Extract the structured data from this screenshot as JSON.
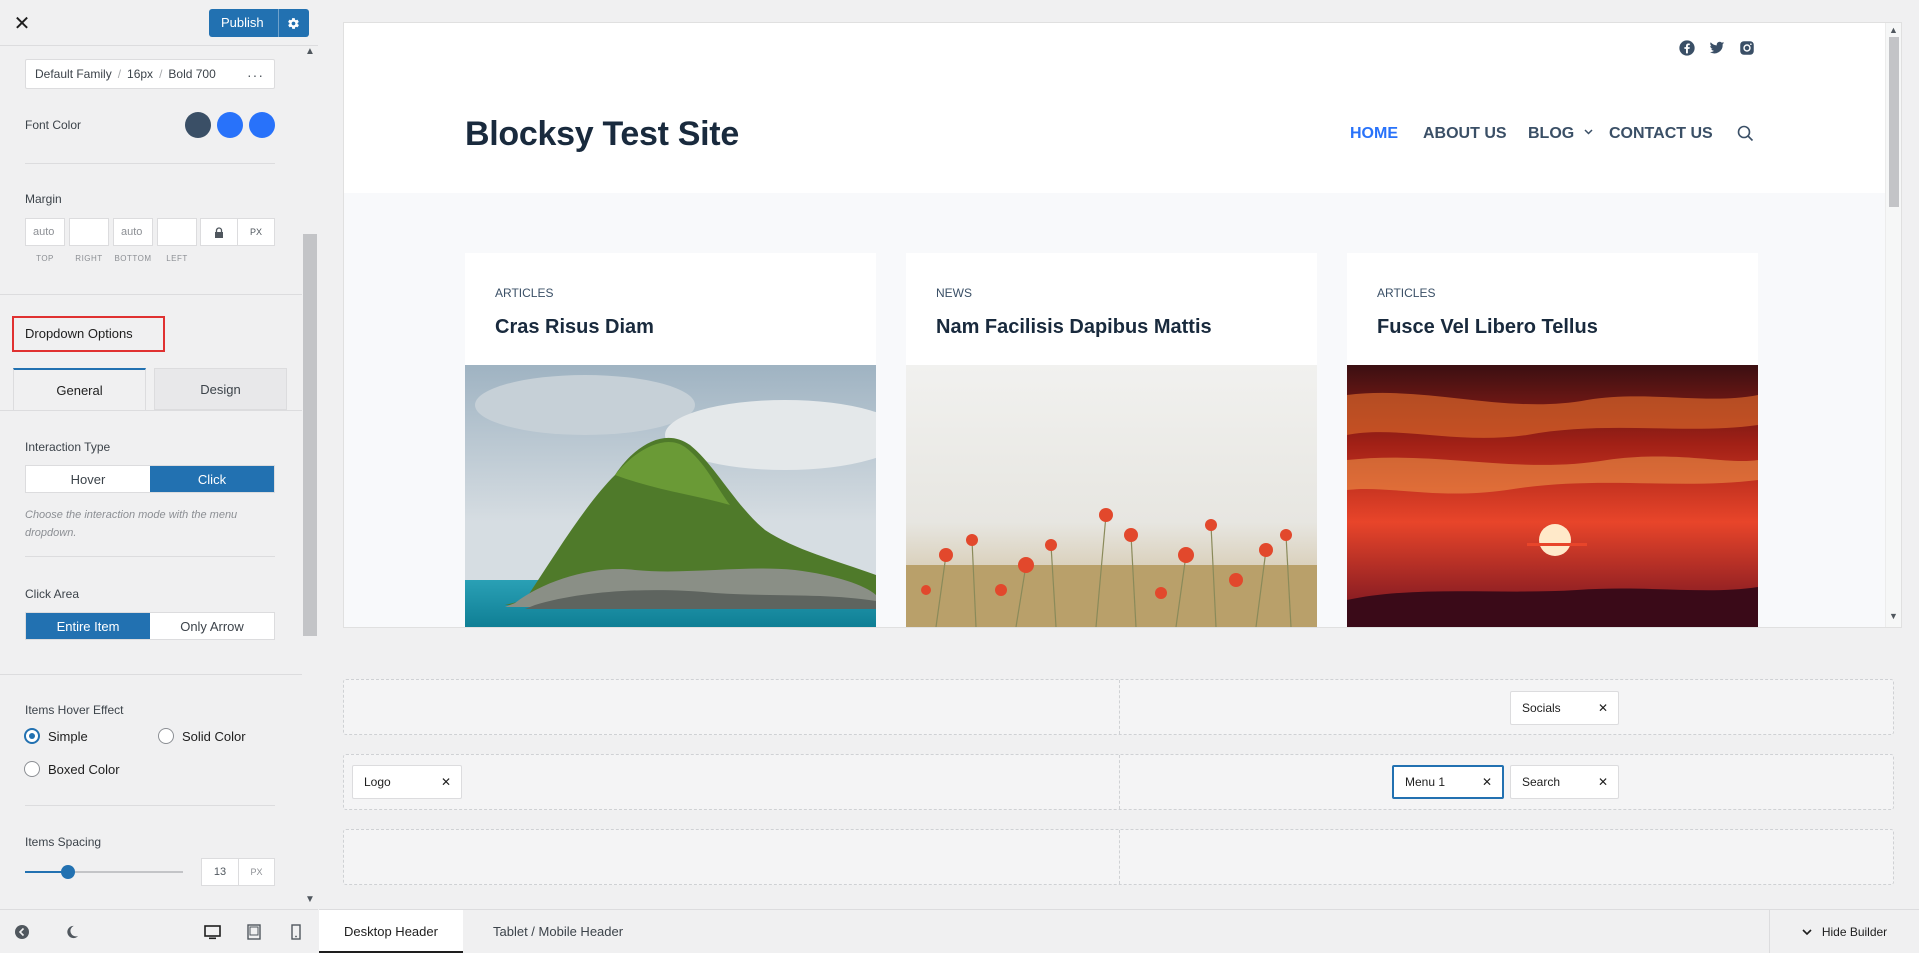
{
  "topbar": {
    "close_glyph": "✕",
    "publish_label": "Publish",
    "publish_settings_icon": "gear-icon"
  },
  "typography": {
    "family": "Default Family",
    "size": "16px",
    "weight": "Bold 700"
  },
  "font_color": {
    "label": "Font Color",
    "colors": [
      "#3a4f66",
      "#2872fa",
      "#2872fa"
    ]
  },
  "margin": {
    "label": "Margin",
    "fields": [
      {
        "placeholder": "auto",
        "sub": "TOP"
      },
      {
        "placeholder": "",
        "sub": "RIGHT"
      },
      {
        "placeholder": "auto",
        "sub": "BOTTOM"
      },
      {
        "placeholder": "",
        "sub": "LEFT"
      }
    ],
    "unit": "PX"
  },
  "dropdown": {
    "heading": "Dropdown Options",
    "tabs": [
      "General",
      "Design"
    ],
    "interaction": {
      "label": "Interaction Type",
      "options": [
        "Hover",
        "Click"
      ],
      "selected": "Click",
      "description": "Choose the interaction mode with the menu dropdown."
    },
    "click_area": {
      "label": "Click Area",
      "options": [
        "Entire Item",
        "Only Arrow"
      ],
      "selected": "Entire Item"
    },
    "hover_effect": {
      "label": "Items Hover Effect",
      "options": [
        "Simple",
        "Solid Color",
        "Boxed Color"
      ],
      "selected": "Simple"
    },
    "spacing": {
      "label": "Items Spacing",
      "value": "13",
      "unit": "PX",
      "fraction": 0.27
    }
  },
  "site": {
    "title": "Blocksy Test Site",
    "nav": [
      "HOME",
      "ABOUT US",
      "BLOG",
      "CONTACT US"
    ],
    "nav_active": "HOME",
    "cards": [
      {
        "category": "ARTICLES",
        "title": "Cras Risus Diam"
      },
      {
        "category": "NEWS",
        "title": "Nam Facilisis Dapibus Mattis"
      },
      {
        "category": "ARTICLES",
        "title": "Fusce Vel Libero Tellus"
      }
    ]
  },
  "builder": {
    "chips": {
      "socials": "Socials",
      "logo": "Logo",
      "menu": "Menu 1",
      "search": "Search"
    },
    "tabs": [
      "Desktop Header",
      "Tablet / Mobile Header"
    ],
    "hide_label": "Hide Builder"
  },
  "colors": {
    "accent": "#2271b1",
    "brand": "#2872fa",
    "heading": "#192a3d",
    "highlight_border": "#e03131"
  }
}
